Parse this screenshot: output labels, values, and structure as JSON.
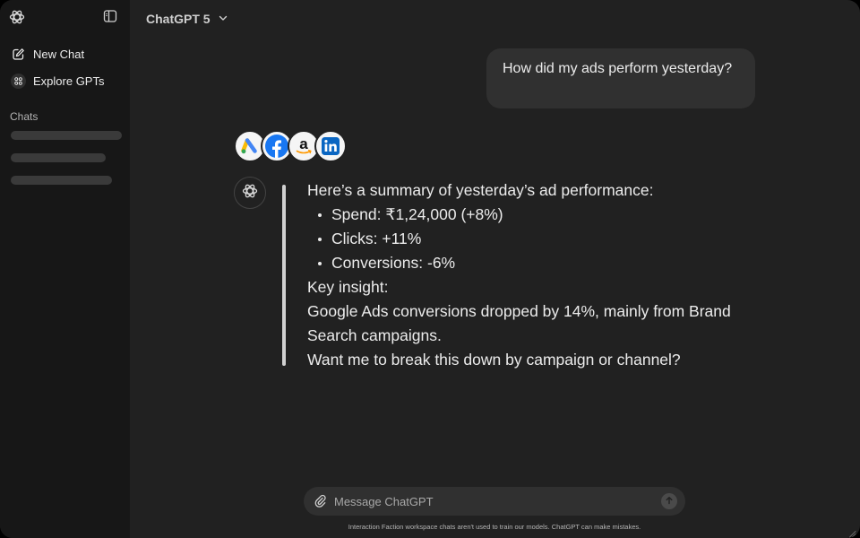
{
  "sidebar": {
    "logo_icon": "openai-logo-icon",
    "toggle_icon": "sidebar-toggle-icon",
    "items": [
      {
        "label": "New Chat",
        "icon": "pencil-square-icon"
      },
      {
        "label": "Explore GPTs",
        "icon": "grid-icon"
      }
    ],
    "chats_label": "Chats"
  },
  "header": {
    "model": "ChatGPT 5",
    "chevron_icon": "chevron-down-icon"
  },
  "conversation": {
    "user_message": "How did my ads perform yesterday?",
    "integrations": [
      {
        "name": "Google Ads",
        "icon": "google-ads-icon"
      },
      {
        "name": "Facebook",
        "icon": "facebook-icon"
      },
      {
        "name": "Amazon",
        "icon": "amazon-icon"
      },
      {
        "name": "LinkedIn",
        "icon": "linkedin-icon"
      }
    ],
    "assistant": {
      "intro": "Here’s a summary of yesterday’s ad performance:",
      "bullets": [
        "Spend: ₹1,24,000 (+8%)",
        "Clicks: +11%",
        "Conversions: -6%"
      ],
      "insight_heading": "Key insight:",
      "insight": "Google Ads conversions dropped by 14%, mainly from Brand Search campaigns.",
      "followup": "Want me to break this down by campaign or channel?"
    }
  },
  "composer": {
    "placeholder": "Message ChatGPT",
    "value": "",
    "attach_icon": "paperclip-icon",
    "send_icon": "arrow-up-icon",
    "disclaimer": "Interaction Faction workspace chats aren't used to train our models. ChatGPT can make mistakes."
  },
  "colors": {
    "background": "#212121",
    "sidebar": "#171717",
    "bubble": "#303030",
    "text": "#ececec",
    "facebook": "#1877F2",
    "linkedin": "#0A66C2",
    "google_blue": "#4285F4",
    "google_yellow": "#FBBC04",
    "google_green": "#34A853",
    "amazon_orange": "#FF9900"
  }
}
